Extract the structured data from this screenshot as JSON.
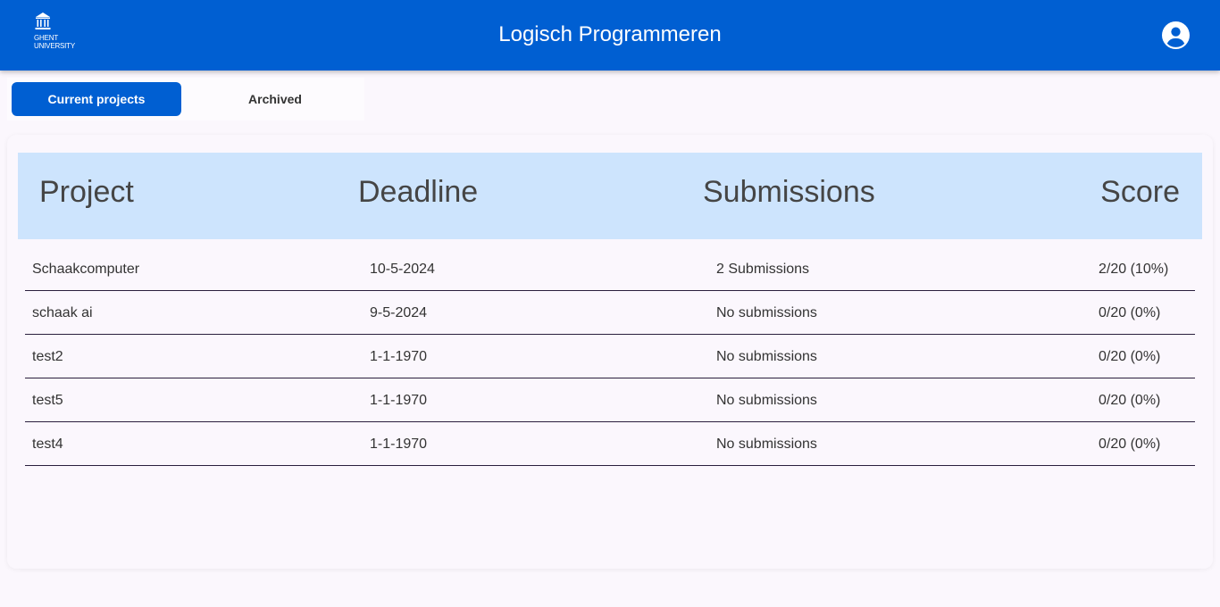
{
  "header": {
    "logo_line1": "GHENT",
    "logo_line2": "UNIVERSITY",
    "title": "Logisch Programmeren"
  },
  "tabs": [
    {
      "label": "Current projects",
      "active": true
    },
    {
      "label": "Archived",
      "active": false
    }
  ],
  "table": {
    "columns": [
      "Project",
      "Deadline",
      "Submissions",
      "Score"
    ],
    "rows": [
      {
        "project": "Schaakcomputer",
        "deadline": "10-5-2024",
        "submissions": "2 Submissions",
        "score": "2/20 (10%)"
      },
      {
        "project": "schaak ai",
        "deadline": "9-5-2024",
        "submissions": "No submissions",
        "score": "0/20 (0%)"
      },
      {
        "project": "test2",
        "deadline": "1-1-1970",
        "submissions": "No submissions",
        "score": "0/20 (0%)"
      },
      {
        "project": "test5",
        "deadline": "1-1-1970",
        "submissions": "No submissions",
        "score": "0/20 (0%)"
      },
      {
        "project": "test4",
        "deadline": "1-1-1970",
        "submissions": "No submissions",
        "score": "0/20 (0%)"
      }
    ]
  },
  "colors": {
    "primary": "#005fd2",
    "table_header": "#cde4fd",
    "background": "#fbf7fd"
  },
  "icons": [
    "university-logo-icon",
    "account-circle-icon"
  ]
}
